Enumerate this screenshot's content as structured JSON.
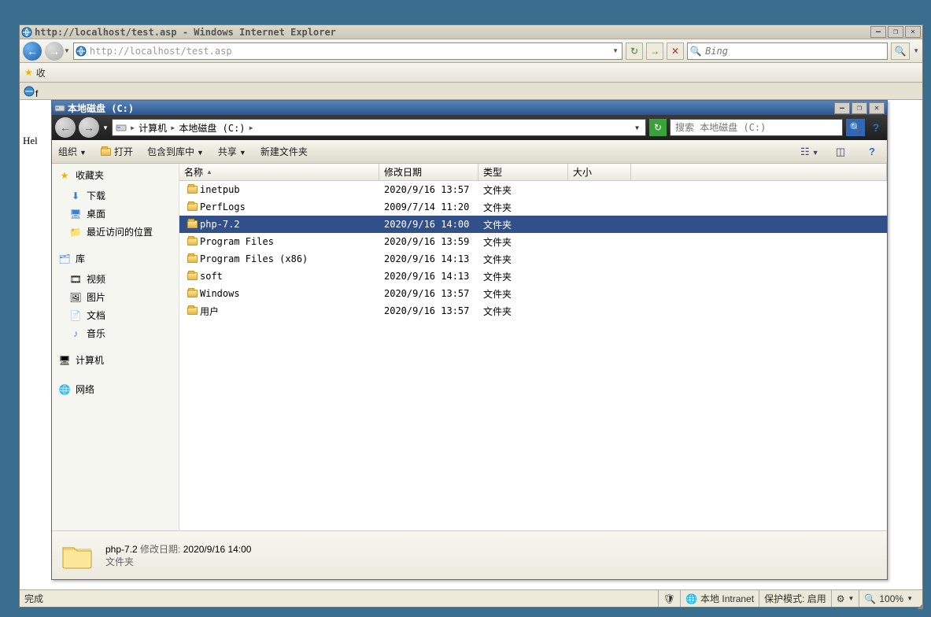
{
  "ie": {
    "title": "http://localhost/test.asp - Windows Internet Explorer",
    "url": "http://localhost/test.asp",
    "search_placeholder": "Bing",
    "favorites_label": "收",
    "tab_label": "f",
    "page_hello": "Hel",
    "status": {
      "done": "完成",
      "zone": "本地 Intranet",
      "protect": "保护模式: 启用",
      "zoom": "100%"
    }
  },
  "explorer": {
    "title": "本地磁盘 (C:)",
    "breadcrumb": [
      "计算机",
      "本地磁盘 (C:)"
    ],
    "search_placeholder": "搜索 本地磁盘 (C:)",
    "toolbar": {
      "organize": "组织",
      "open": "打开",
      "include": "包含到库中",
      "share": "共享",
      "newfolder": "新建文件夹"
    },
    "columns": {
      "name": "名称",
      "date": "修改日期",
      "type": "类型",
      "size": "大小"
    },
    "sidebar": {
      "favorites": "收藏夹",
      "favorites_items": [
        "下载",
        "桌面",
        "最近访问的位置"
      ],
      "libraries": "库",
      "libraries_items": [
        "视频",
        "图片",
        "文档",
        "音乐"
      ],
      "computer": "计算机",
      "network": "网络"
    },
    "rows": [
      {
        "name": "inetpub",
        "date": "2020/9/16 13:57",
        "type": "文件夹",
        "size": "",
        "selected": false
      },
      {
        "name": "PerfLogs",
        "date": "2009/7/14 11:20",
        "type": "文件夹",
        "size": "",
        "selected": false
      },
      {
        "name": "php-7.2",
        "date": "2020/9/16 14:00",
        "type": "文件夹",
        "size": "",
        "selected": true
      },
      {
        "name": "Program Files",
        "date": "2020/9/16 13:59",
        "type": "文件夹",
        "size": "",
        "selected": false
      },
      {
        "name": "Program Files (x86)",
        "date": "2020/9/16 14:13",
        "type": "文件夹",
        "size": "",
        "selected": false
      },
      {
        "name": "soft",
        "date": "2020/9/16 14:13",
        "type": "文件夹",
        "size": "",
        "selected": false
      },
      {
        "name": "Windows",
        "date": "2020/9/16 13:57",
        "type": "文件夹",
        "size": "",
        "selected": false
      },
      {
        "name": "用户",
        "date": "2020/9/16 13:57",
        "type": "文件夹",
        "size": "",
        "selected": false
      }
    ],
    "details": {
      "name": "php-7.2",
      "date_label": "修改日期:",
      "date": "2020/9/16 14:00",
      "type": "文件夹"
    }
  }
}
